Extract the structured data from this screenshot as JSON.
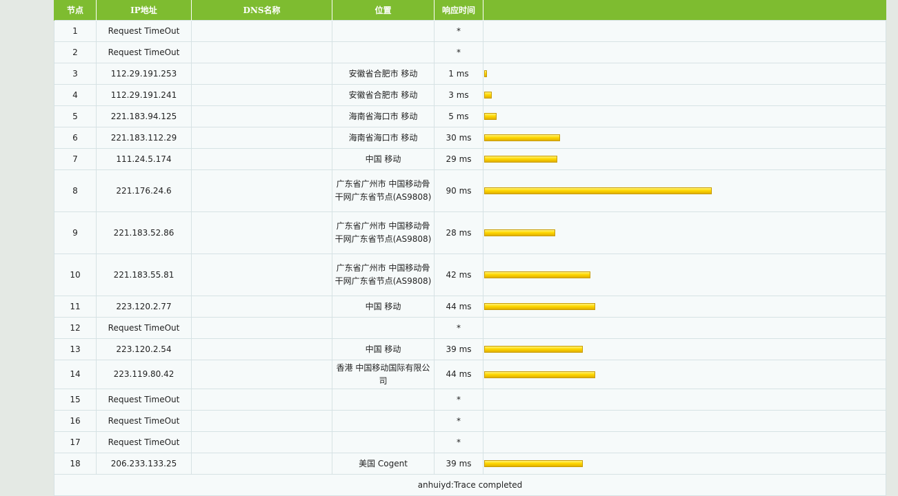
{
  "headers": {
    "hop": "节点",
    "ip": "IP地址",
    "dns": "DNS名称",
    "location": "位置",
    "time": "响应时间"
  },
  "rows": [
    {
      "hop": "1",
      "ip": "Request TimeOut",
      "dns": "",
      "location": "",
      "time": "*",
      "ms": 0
    },
    {
      "hop": "2",
      "ip": "Request TimeOut",
      "dns": "",
      "location": "",
      "time": "*",
      "ms": 0
    },
    {
      "hop": "3",
      "ip": "112.29.191.253",
      "dns": "",
      "location": "安徽省合肥市 移动",
      "time": "1 ms",
      "ms": 1
    },
    {
      "hop": "4",
      "ip": "112.29.191.241",
      "dns": "",
      "location": "安徽省合肥市 移动",
      "time": "3 ms",
      "ms": 3
    },
    {
      "hop": "5",
      "ip": "221.183.94.125",
      "dns": "",
      "location": "海南省海口市 移动",
      "time": "5 ms",
      "ms": 5
    },
    {
      "hop": "6",
      "ip": "221.183.112.29",
      "dns": "",
      "location": "海南省海口市 移动",
      "time": "30 ms",
      "ms": 30
    },
    {
      "hop": "7",
      "ip": "111.24.5.174",
      "dns": "",
      "location": "中国 移动",
      "time": "29 ms",
      "ms": 29
    },
    {
      "hop": "8",
      "ip": "221.176.24.6",
      "dns": "",
      "location": "广东省广州市 中国移动骨干网广东省节点(AS9808)",
      "time": "90 ms",
      "ms": 90
    },
    {
      "hop": "9",
      "ip": "221.183.52.86",
      "dns": "",
      "location": "广东省广州市 中国移动骨干网广东省节点(AS9808)",
      "time": "28 ms",
      "ms": 28
    },
    {
      "hop": "10",
      "ip": "221.183.55.81",
      "dns": "",
      "location": "广东省广州市 中国移动骨干网广东省节点(AS9808)",
      "time": "42 ms",
      "ms": 42
    },
    {
      "hop": "11",
      "ip": "223.120.2.77",
      "dns": "",
      "location": "中国 移动",
      "time": "44 ms",
      "ms": 44
    },
    {
      "hop": "12",
      "ip": "Request TimeOut",
      "dns": "",
      "location": "",
      "time": "*",
      "ms": 0
    },
    {
      "hop": "13",
      "ip": "223.120.2.54",
      "dns": "",
      "location": "中国 移动",
      "time": "39 ms",
      "ms": 39
    },
    {
      "hop": "14",
      "ip": "223.119.80.42",
      "dns": "",
      "location": "香港 中国移动国际有限公司",
      "time": "44 ms",
      "ms": 44
    },
    {
      "hop": "15",
      "ip": "Request TimeOut",
      "dns": "",
      "location": "",
      "time": "*",
      "ms": 0
    },
    {
      "hop": "16",
      "ip": "Request TimeOut",
      "dns": "",
      "location": "",
      "time": "*",
      "ms": 0
    },
    {
      "hop": "17",
      "ip": "Request TimeOut",
      "dns": "",
      "location": "",
      "time": "*",
      "ms": 0
    },
    {
      "hop": "18",
      "ip": "206.233.133.25",
      "dns": "",
      "location": "美国 Cogent",
      "time": "39 ms",
      "ms": 39
    }
  ],
  "footer": "anhuiyd:Trace completed",
  "colors": {
    "header_bg": "#7ebc30",
    "bar": "#ffd800",
    "row_bg": "#f6fafa"
  }
}
